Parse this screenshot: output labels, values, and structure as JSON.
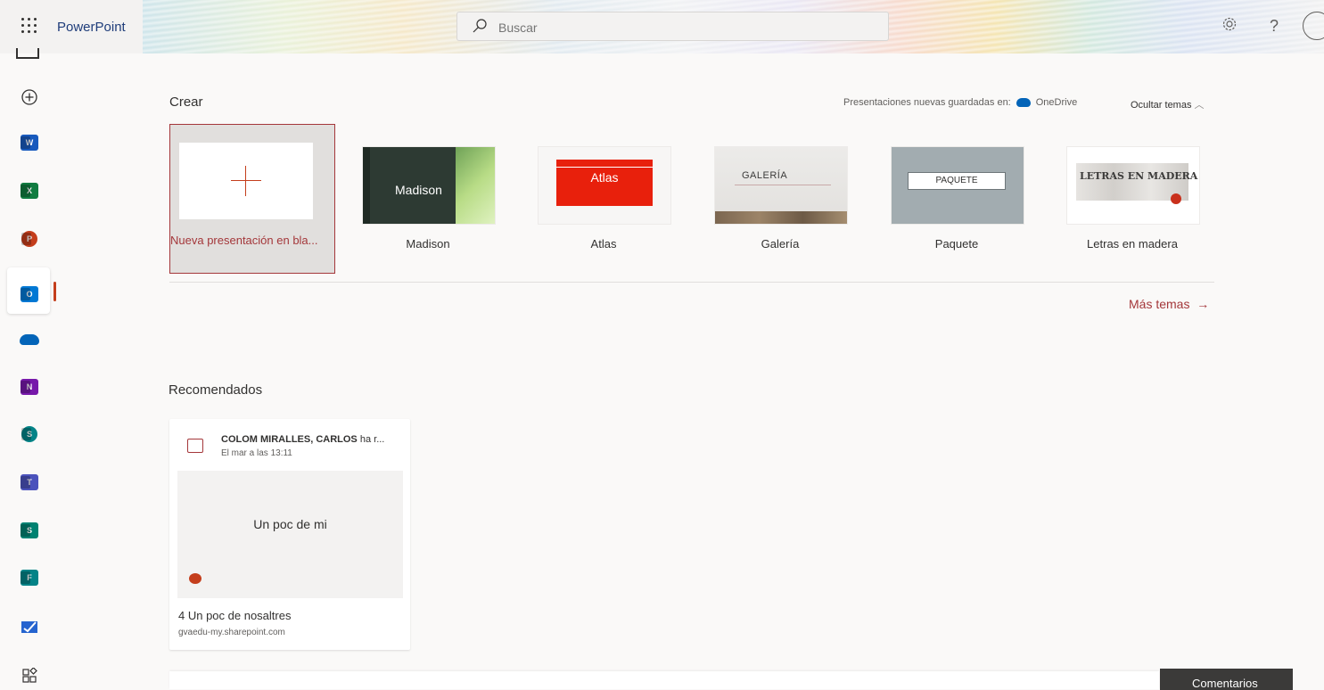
{
  "header": {
    "app_name": "PowerPoint",
    "search_placeholder": "Buscar",
    "help_label": "?"
  },
  "rail": {
    "items": [
      {
        "name": "create",
        "label": "+"
      },
      {
        "name": "word",
        "letter": "W",
        "color": "#185abd"
      },
      {
        "name": "excel",
        "letter": "X",
        "color": "#107c41"
      },
      {
        "name": "powerpoint",
        "letter": "P",
        "color": "#c43e1c"
      },
      {
        "name": "outlook",
        "letter": "O",
        "color": "#0078d4"
      },
      {
        "name": "onedrive",
        "letter": "",
        "color": "#0364b8"
      },
      {
        "name": "onenote",
        "letter": "N",
        "color": "#7719aa"
      },
      {
        "name": "sharepoint",
        "letter": "S",
        "color": "#038387"
      },
      {
        "name": "teams",
        "letter": "T",
        "color": "#4b53bc"
      },
      {
        "name": "sway",
        "letter": "S",
        "color": "#008272"
      },
      {
        "name": "forms",
        "letter": "F",
        "color": "#038387"
      },
      {
        "name": "todo",
        "letter": "",
        "color": "#2564cf"
      }
    ]
  },
  "create": {
    "title": "Crear",
    "saved_in_label": "Presentaciones nuevas guardadas en:",
    "saved_in_location": "OneDrive",
    "hide_themes": "Ocultar temas",
    "more_themes": "Más temas",
    "blank_label": "Nueva presentación en bla...",
    "themes": [
      {
        "label": "Madison",
        "thumb_text": "Madison"
      },
      {
        "label": "Atlas",
        "thumb_text": "Atlas"
      },
      {
        "label": "Galería",
        "thumb_text": "GALERÍA"
      },
      {
        "label": "Paquete",
        "thumb_text": "PAQUETE"
      },
      {
        "label": "Letras en madera",
        "thumb_text": "LETRAS EN MADERA"
      }
    ]
  },
  "recommended": {
    "title": "Recomendados",
    "card": {
      "author": "COLOM MIRALLES, CARLOS",
      "action": "ha r...",
      "when": "El mar a las 13:11",
      "preview_title": "Un poc de mi",
      "file_name": "4 Un poc de nosaltres",
      "site": "gvaedu-my.sharepoint.com"
    }
  },
  "feedback": {
    "label": "Comentarios"
  },
  "colors": {
    "accent": "#c43e1c",
    "accent_dark": "#a4373a",
    "brand_blue": "#1f3d7a"
  }
}
